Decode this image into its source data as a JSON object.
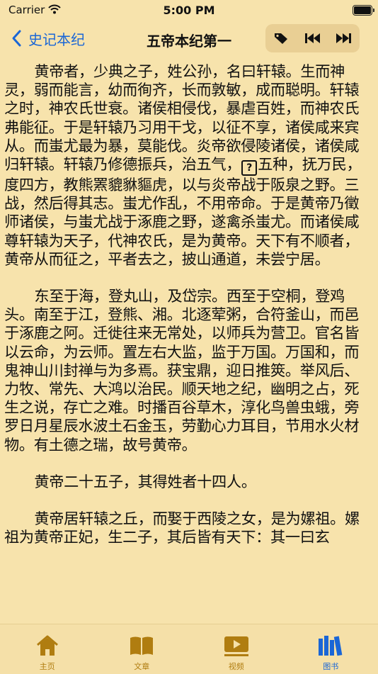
{
  "status_bar": {
    "carrier": "Carrier",
    "time": "5:00 PM"
  },
  "nav": {
    "back_label": "史记本纪",
    "title": "五帝本纪第一"
  },
  "toolbar": {
    "icons": [
      "tag-icon",
      "skip-back-icon",
      "skip-forward-icon"
    ]
  },
  "content": {
    "p1_a": "黄帝者，少典之子，姓公孙，名曰轩辕。生而神灵，弱而能言，幼而徇齐，长而敦敏，成而聪明。轩辕之时，神农氏世衰。诸侯相侵伐，暴虐百姓，而神农氏弗能征。于是轩辕乃习用干戈，以征不享，诸侯咸来宾从。而蚩尤最为暴，莫能伐。炎帝欲侵陵诸侯，诸侯咸归轩辕。轩辕乃修德振兵，治五气，",
    "p1_unknown": "?",
    "p1_b": "五种，抚万民，度四方，教熊罴貔貅貙虎，以与炎帝战于阪泉之野。三战，然后得其志。蚩尤作乱，不用帝命。于是黄帝乃徵师诸侯，与蚩尤战于涿鹿之野，遂禽杀蚩尤。而诸侯咸尊轩辕为天子，代神农氏，是为黄帝。天下有不顺者，黄帝从而征之，平者去之，披山通道，未尝宁居。",
    "p2": "东至于海，登丸山，及岱宗。西至于空桐，登鸡头。南至于江，登熊、湘。北逐荤粥，合符釜山，而邑于涿鹿之阿。迁徙往来无常处，以师兵为营卫。官名皆以云命，为云师。置左右大监，监于万国。万国和，而鬼神山川封禅与为多焉。获宝鼎，迎日推筴。举风后、力牧、常先、大鸿以治民。顺天地之纪，幽明之占，死生之说，存亡之难。时播百谷草木，淳化鸟兽虫蛾，旁罗日月星辰水波土石金玉，劳勤心力耳目，节用水火材物。有土德之瑞，故号黄帝。",
    "p3": "黄帝二十五子，其得姓者十四人。",
    "p4": "黄帝居轩辕之丘，而娶于西陵之女，是为嫘祖。嫘祖为黄帝正妃，生二子，其后皆有天下：其一曰玄"
  },
  "tabs": [
    {
      "label": "主页",
      "icon": "home-icon",
      "active": false
    },
    {
      "label": "文章",
      "icon": "book-icon",
      "active": false
    },
    {
      "label": "视频",
      "icon": "video-icon",
      "active": false
    },
    {
      "label": "图书",
      "icon": "library-icon",
      "active": true
    }
  ],
  "colors": {
    "background": "#f7e3ac",
    "accent": "#1a66d6",
    "tab_inactive": "#b07d10"
  }
}
